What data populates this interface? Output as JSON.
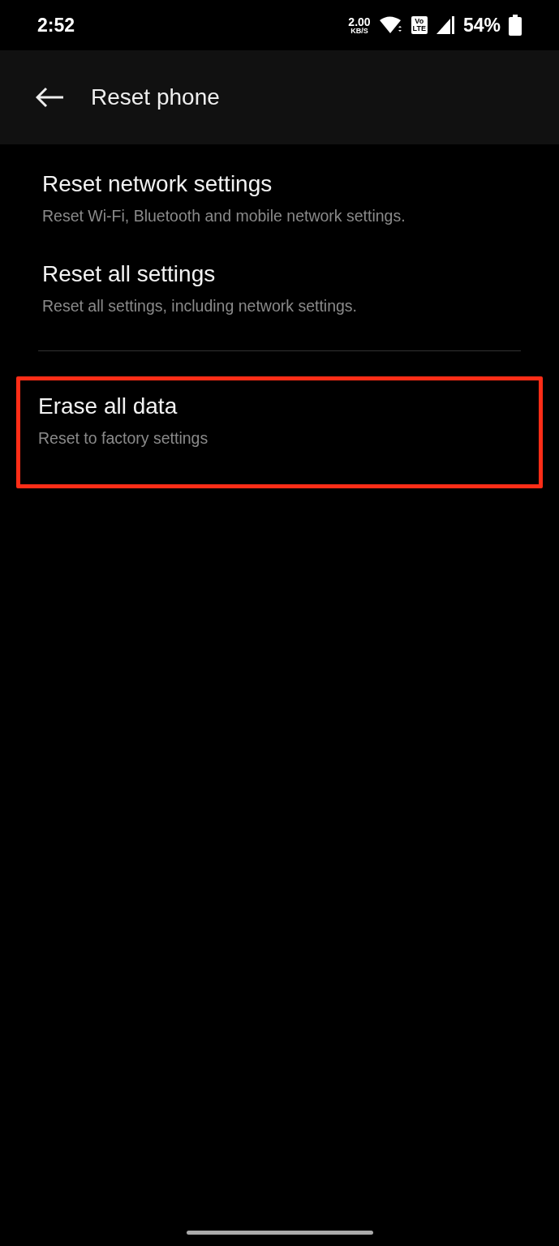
{
  "status_bar": {
    "time": "2:52",
    "speed_value": "2.00",
    "speed_unit": "KB/S",
    "volte_top": "Vo",
    "volte_bottom": "LTE",
    "battery": "54%"
  },
  "app_bar": {
    "title": "Reset phone"
  },
  "sections": [
    {
      "items": [
        {
          "title": "Reset network settings",
          "subtitle": "Reset Wi-Fi, Bluetooth and mobile network settings.",
          "highlighted": false
        },
        {
          "title": "Reset all settings",
          "subtitle": "Reset all settings, including network settings.",
          "highlighted": false
        }
      ]
    },
    {
      "items": [
        {
          "title": "Erase all data",
          "subtitle": "Reset to factory settings",
          "highlighted": true
        }
      ]
    }
  ]
}
